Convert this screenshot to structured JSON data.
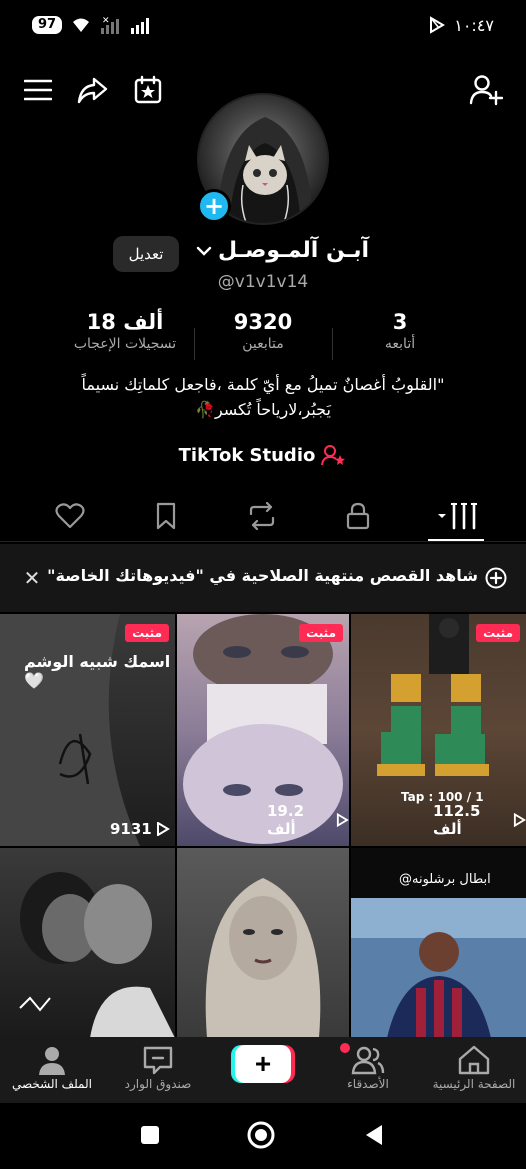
{
  "status_bar": {
    "battery": "97",
    "time": "١٠:٤٧"
  },
  "profile": {
    "name": "آبـن آلمـوصـل",
    "username": "@v1v1v14",
    "edit_label": "تعديل",
    "stats": [
      {
        "value": "3",
        "label": "أتابعه"
      },
      {
        "value": "9320",
        "label": "متابعين"
      },
      {
        "value": "18 ألف",
        "label": "تسجيلات الإعجاب"
      }
    ],
    "bio_line1": "\"القلوبُ أغصانٌ تميلُ مع أيّ كلمة ،فاجعل كلماتِك نسيماً",
    "bio_line2": "يَجبُر،لارياحاً تُكسر🥀",
    "studio_label": "TikTok Studio"
  },
  "banner": {
    "text": "شاهد القصص منتهية الصلاحية في \"فيديوهاتك الخاصة\""
  },
  "videos": [
    {
      "pinned": "مثبت",
      "views": "112.5 ألف",
      "overlay": "Tap : 100 / 1"
    },
    {
      "pinned": "مثبت",
      "views": "19.2 ألف"
    },
    {
      "pinned": "مثبت",
      "views": "9131",
      "overlay": "اسمك شبيه الوشم🤍"
    },
    {
      "overlay": "@ابطال برشلونه"
    },
    {},
    {}
  ],
  "bottom_nav": {
    "home": "الصفحة الرئيسية",
    "friends": "الأصدقاء",
    "create": "+",
    "inbox": "صندوق الوارد",
    "profile": "الملف الشخصي"
  },
  "colors": {
    "accent": "#fe2c55",
    "cyan": "#25f4ee",
    "plus_badge": "#20b8f0"
  }
}
